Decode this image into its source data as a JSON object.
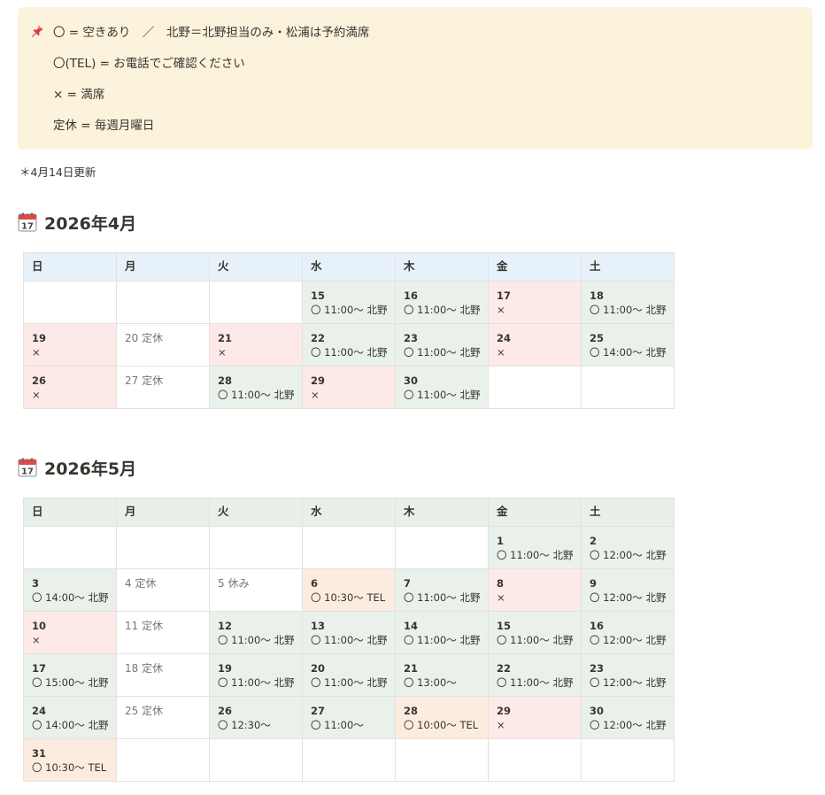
{
  "callout": {
    "icon": "pushpin-icon",
    "lines": [
      "〇 = 空きあり　／　北野＝北野担当のみ・松浦は予約満席",
      "〇(TEL) = お電話でご確認ください",
      "× = 満席",
      "定休 = 毎週月曜日"
    ]
  },
  "update_note": "＊4月14日更新",
  "april": {
    "icon": "calendar-icon",
    "title": "2026年4月",
    "headers": [
      "日",
      "月",
      "火",
      "水",
      "木",
      "金",
      "土"
    ],
    "rows": [
      [
        {
          "d": "",
          "s": "",
          "c": "white"
        },
        {
          "d": "",
          "s": "",
          "c": "white"
        },
        {
          "d": "",
          "s": "",
          "c": "white"
        },
        {
          "d": "15",
          "s": "〇 11:00〜 北野",
          "c": "green"
        },
        {
          "d": "16",
          "s": "〇 11:00〜 北野",
          "c": "green"
        },
        {
          "d": "17",
          "s": "×",
          "c": "red"
        },
        {
          "d": "18",
          "s": "〇 11:00〜 北野",
          "c": "green"
        }
      ],
      [
        {
          "d": "19",
          "s": "×",
          "c": "red"
        },
        {
          "d": "20 定休",
          "s": "",
          "c": "white",
          "light": true
        },
        {
          "d": "21",
          "s": "×",
          "c": "red"
        },
        {
          "d": "22",
          "s": "〇 11:00〜 北野",
          "c": "green"
        },
        {
          "d": "23",
          "s": "〇 11:00〜 北野",
          "c": "green"
        },
        {
          "d": "24",
          "s": "×",
          "c": "red"
        },
        {
          "d": "25",
          "s": "〇 14:00〜 北野",
          "c": "green"
        }
      ],
      [
        {
          "d": "26",
          "s": "×",
          "c": "red"
        },
        {
          "d": "27 定休",
          "s": "",
          "c": "white",
          "light": true
        },
        {
          "d": "28",
          "s": "〇 11:00〜 北野",
          "c": "green"
        },
        {
          "d": "29",
          "s": "×",
          "c": "red"
        },
        {
          "d": "30",
          "s": "〇 11:00〜 北野",
          "c": "green"
        },
        {
          "d": "",
          "s": "",
          "c": "white"
        },
        {
          "d": "",
          "s": "",
          "c": "white"
        }
      ]
    ]
  },
  "may": {
    "icon": "calendar-icon",
    "title": "2026年5月",
    "headers": [
      "日",
      "月",
      "火",
      "水",
      "木",
      "金",
      "土"
    ],
    "rows": [
      [
        {
          "d": "",
          "s": "",
          "c": "white"
        },
        {
          "d": "",
          "s": "",
          "c": "white"
        },
        {
          "d": "",
          "s": "",
          "c": "white"
        },
        {
          "d": "",
          "s": "",
          "c": "white"
        },
        {
          "d": "",
          "s": "",
          "c": "white"
        },
        {
          "d": "1",
          "s": "〇 11:00〜 北野",
          "c": "green"
        },
        {
          "d": "2",
          "s": "〇 12:00〜 北野",
          "c": "green"
        }
      ],
      [
        {
          "d": "3",
          "s": "〇 14:00〜 北野",
          "c": "green"
        },
        {
          "d": "4 定休",
          "s": "",
          "c": "white",
          "light": true
        },
        {
          "d": "5 休み",
          "s": "",
          "c": "white",
          "light": true
        },
        {
          "d": "6",
          "s": "〇 10:30〜 TEL",
          "c": "orange"
        },
        {
          "d": "7",
          "s": "〇 11:00〜 北野",
          "c": "green"
        },
        {
          "d": "8",
          "s": "×",
          "c": "red"
        },
        {
          "d": "9",
          "s": "〇 12:00〜 北野",
          "c": "green"
        }
      ],
      [
        {
          "d": "10",
          "s": "×",
          "c": "red"
        },
        {
          "d": "11 定休",
          "s": "",
          "c": "white",
          "light": true
        },
        {
          "d": "12",
          "s": "〇 11:00〜 北野",
          "c": "green"
        },
        {
          "d": "13",
          "s": "〇 11:00〜 北野",
          "c": "green"
        },
        {
          "d": "14",
          "s": "〇 11:00〜 北野",
          "c": "green"
        },
        {
          "d": "15",
          "s": "〇 11:00〜 北野",
          "c": "green"
        },
        {
          "d": "16",
          "s": "〇 12:00〜 北野",
          "c": "green"
        }
      ],
      [
        {
          "d": "17",
          "s": "〇 15:00〜 北野",
          "c": "green"
        },
        {
          "d": "18 定休",
          "s": "",
          "c": "white",
          "light": true
        },
        {
          "d": "19",
          "s": "〇 11:00〜 北野",
          "c": "green"
        },
        {
          "d": "20",
          "s": "〇 11:00〜 北野",
          "c": "green"
        },
        {
          "d": "21",
          "s": "〇 13:00〜",
          "c": "green"
        },
        {
          "d": "22",
          "s": "〇 11:00〜 北野",
          "c": "green"
        },
        {
          "d": "23",
          "s": "〇 12:00〜 北野",
          "c": "green"
        }
      ],
      [
        {
          "d": "24",
          "s": "〇 14:00〜 北野",
          "c": "green"
        },
        {
          "d": "25 定休",
          "s": "",
          "c": "white",
          "light": true
        },
        {
          "d": "26",
          "s": "〇 12:30〜",
          "c": "green"
        },
        {
          "d": "27",
          "s": "〇 11:00〜",
          "c": "green"
        },
        {
          "d": "28",
          "s": "〇 10:00〜 TEL",
          "c": "orange"
        },
        {
          "d": "29",
          "s": "×",
          "c": "red"
        },
        {
          "d": "30",
          "s": "〇 12:00〜 北野",
          "c": "green"
        }
      ],
      [
        {
          "d": "31",
          "s": "〇 10:30〜 TEL",
          "c": "orange"
        },
        {
          "d": "",
          "s": "",
          "c": "white"
        },
        {
          "d": "",
          "s": "",
          "c": "white"
        },
        {
          "d": "",
          "s": "",
          "c": "white"
        },
        {
          "d": "",
          "s": "",
          "c": "white"
        },
        {
          "d": "",
          "s": "",
          "c": "white"
        },
        {
          "d": "",
          "s": "",
          "c": "white"
        }
      ]
    ]
  }
}
